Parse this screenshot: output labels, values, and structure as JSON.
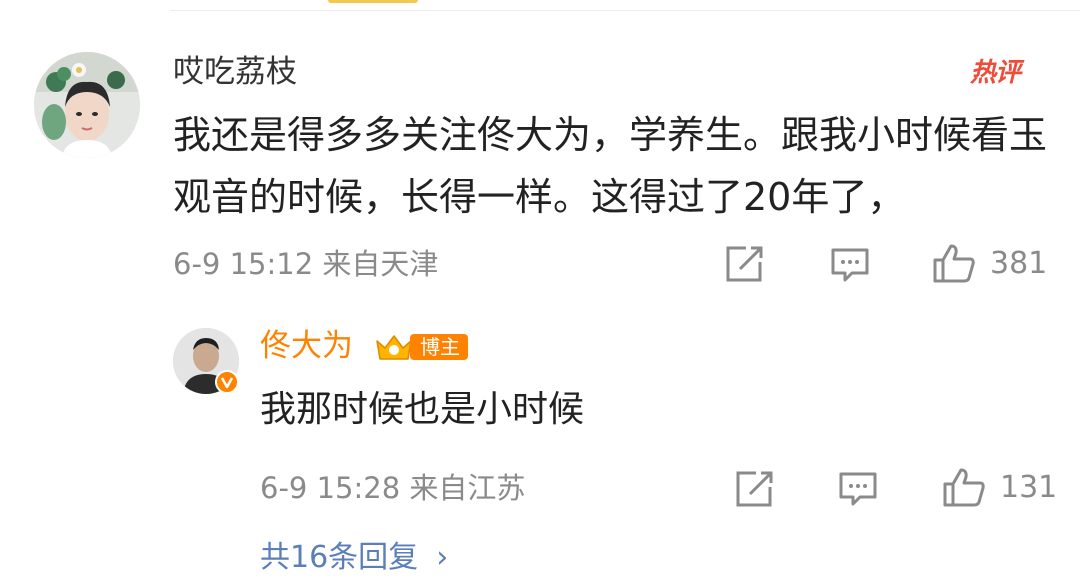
{
  "comment": {
    "username": "哎吃荔枝",
    "hot_badge": "热评",
    "text": "我还是得多多关注佟大为，学养生。跟我小时候看玉观音的时候，长得一样。这得过了20年了，",
    "meta": "6-9 15:12 来自天津",
    "like_count": "381"
  },
  "reply": {
    "username": "佟大为",
    "badge_label": "博主",
    "text": "我那时候也是小时候",
    "meta": "6-9 15:28 来自江苏",
    "like_count": "131"
  },
  "more_replies": {
    "label": "共16条回复",
    "chevron": "›"
  },
  "icons": {
    "share": "share-icon",
    "comment": "comment-icon",
    "like": "thumbs-up-icon",
    "verified": "verified-icon",
    "crown": "crown-icon"
  },
  "colors": {
    "username_reply": "#ff8200",
    "hot_badge": "#ee4d3a",
    "link": "#5b7fb8",
    "meta": "#8a8a8a"
  }
}
